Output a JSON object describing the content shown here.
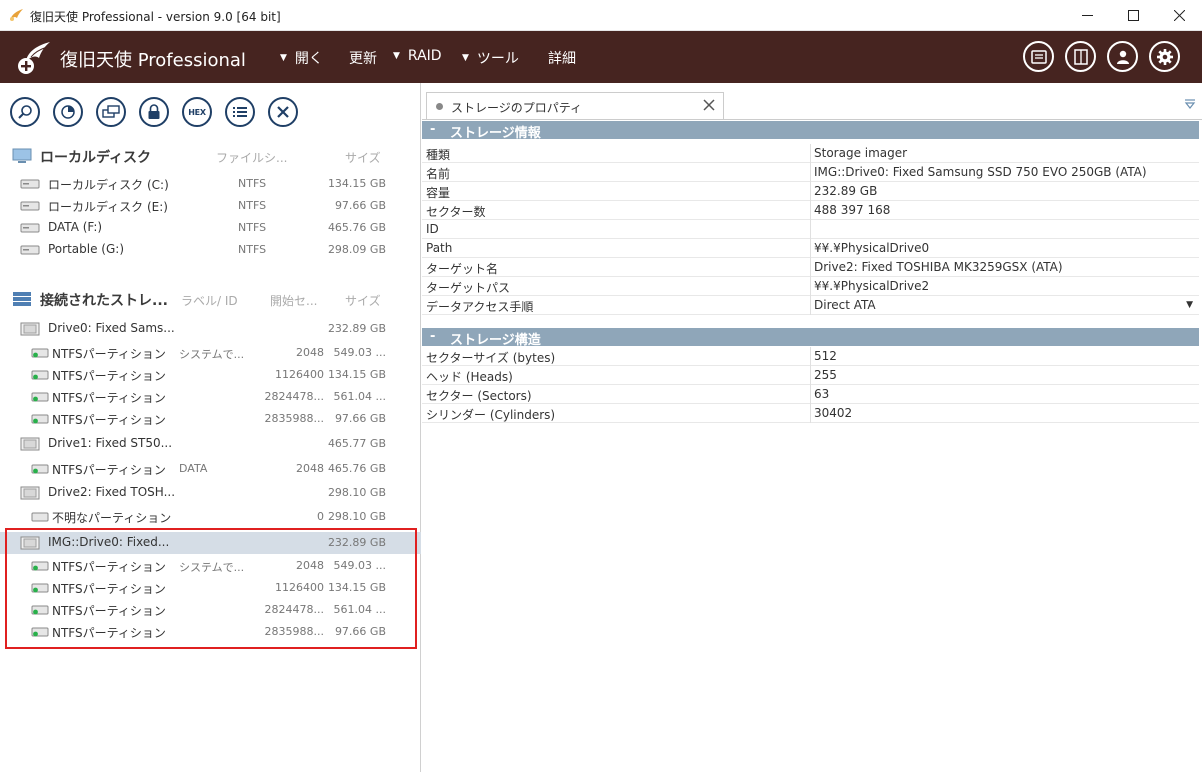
{
  "window": {
    "title": "復旧天使 Professional - version 9.0 [64 bit]"
  },
  "header": {
    "brand": "復旧天使 Professional",
    "menus": [
      {
        "label": "開く",
        "arrow": "▼"
      },
      {
        "label": "更新",
        "arrow": ""
      },
      {
        "label": "RAID",
        "arrow": "▼"
      },
      {
        "label": "ツール",
        "arrow": "▼"
      },
      {
        "label": "詳細",
        "arrow": ""
      }
    ]
  },
  "toolbar": {
    "hex_label": "HEX"
  },
  "local_disks": {
    "title": "ローカルディスク",
    "col_fs": "ファイルシ...",
    "col_size": "サイズ",
    "items": [
      {
        "name": "ローカルディスク (C:)",
        "fs": "NTFS",
        "size": "134.15 GB"
      },
      {
        "name": "ローカルディスク (E:)",
        "fs": "NTFS",
        "size": "97.66 GB"
      },
      {
        "name": "DATA (F:)",
        "fs": "NTFS",
        "size": "465.76 GB"
      },
      {
        "name": "Portable (G:)",
        "fs": "NTFS",
        "size": "298.09 GB"
      }
    ]
  },
  "connected": {
    "title": "接続されたストレ...",
    "col_label": "ラベル/ ID",
    "col_start": "開始セ...",
    "col_size": "サイズ",
    "rows": [
      {
        "type": "drive",
        "name": "Drive0: Fixed Sams...",
        "label": "",
        "start": "",
        "size": "232.89 GB"
      },
      {
        "type": "part",
        "name": "NTFSパーティション",
        "label": "システムで...",
        "start": "2048",
        "size": "549.03 ..."
      },
      {
        "type": "part",
        "name": "NTFSパーティション",
        "label": "",
        "start": "1126400",
        "size": "134.15 GB"
      },
      {
        "type": "part",
        "name": "NTFSパーティション",
        "label": "",
        "start": "2824478...",
        "size": "561.04 ..."
      },
      {
        "type": "part",
        "name": "NTFSパーティション",
        "label": "",
        "start": "2835988...",
        "size": "97.66 GB"
      },
      {
        "type": "drive",
        "name": "Drive1: Fixed ST50...",
        "label": "",
        "start": "",
        "size": "465.77 GB"
      },
      {
        "type": "part",
        "name": "NTFSパーティション",
        "label": "DATA",
        "start": "2048",
        "size": "465.76 GB"
      },
      {
        "type": "drive",
        "name": "Drive2: Fixed TOSH...",
        "label": "",
        "start": "",
        "size": "298.10 GB"
      },
      {
        "type": "part-unknown",
        "name": "不明なパーティション",
        "label": "",
        "start": "0",
        "size": "298.10 GB"
      },
      {
        "type": "drive-selected",
        "name": "IMG::Drive0: Fixed...",
        "label": "",
        "start": "",
        "size": "232.89 GB"
      },
      {
        "type": "part",
        "name": "NTFSパーティション",
        "label": "システムで...",
        "start": "2048",
        "size": "549.03 ..."
      },
      {
        "type": "part",
        "name": "NTFSパーティション",
        "label": "",
        "start": "1126400",
        "size": "134.15 GB"
      },
      {
        "type": "part",
        "name": "NTFSパーティション",
        "label": "",
        "start": "2824478...",
        "size": "561.04 ..."
      },
      {
        "type": "part",
        "name": "NTFSパーティション",
        "label": "",
        "start": "2835988...",
        "size": "97.66 GB"
      }
    ]
  },
  "properties": {
    "tab_title": "ストレージのプロパティ",
    "group1": "ストレージ情報",
    "group1_rows": [
      {
        "k": "種類",
        "v": "Storage imager"
      },
      {
        "k": "名前",
        "v": "IMG::Drive0: Fixed Samsung SSD 750 EVO 250GB (ATA)"
      },
      {
        "k": "容量",
        "v": "232.89 GB"
      },
      {
        "k": "セクター数",
        "v": "488 397 168"
      },
      {
        "k": "ID",
        "v": ""
      },
      {
        "k": "Path",
        "v": "¥¥.¥PhysicalDrive0"
      },
      {
        "k": "ターゲット名",
        "v": "Drive2: Fixed TOSHIBA MK3259GSX (ATA)"
      },
      {
        "k": "ターゲットパス",
        "v": "¥¥.¥PhysicalDrive2"
      },
      {
        "k": "データアクセス手順",
        "v": "Direct ATA"
      }
    ],
    "group2": "ストレージ構造",
    "group2_rows": [
      {
        "k": "セクターサイズ (bytes)",
        "v": "512"
      },
      {
        "k": "ヘッド (Heads)",
        "v": "255"
      },
      {
        "k": "セクター (Sectors)",
        "v": "63"
      },
      {
        "k": "シリンダー (Cylinders)",
        "v": "30402"
      }
    ]
  },
  "colors": {
    "header_bg": "#462420",
    "group_bg": "#8fa6b9",
    "selection_bg": "#d5dde6",
    "highlight_border": "#e02020",
    "tool_icon": "#1f3f66"
  }
}
